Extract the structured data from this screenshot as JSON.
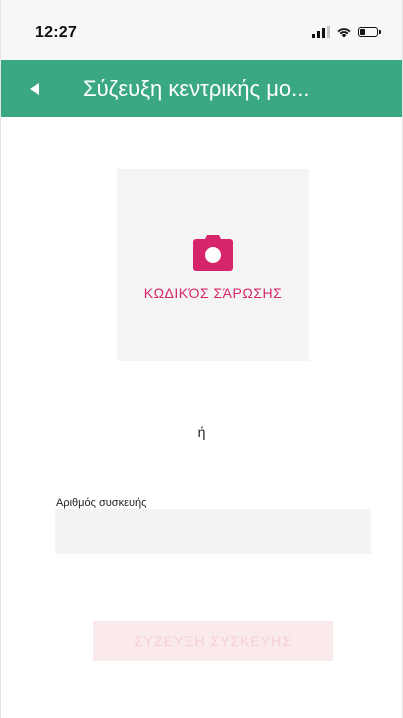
{
  "status_bar": {
    "time": "12:27",
    "icons": [
      "signal-icon",
      "wifi-icon",
      "battery-icon"
    ]
  },
  "app_bar": {
    "title": "Σύζευξη κεντρικής μο...",
    "back_icon": "back-arrow-icon",
    "color": "#3aa981"
  },
  "scan": {
    "icon": "camera-icon",
    "label": "ΚΩΔΙΚΌΣ ΣΆΡΩΣΗΣ",
    "accent_color": "#d6256a"
  },
  "divider_text": "ή",
  "device_field": {
    "label": "Αριθμός συσκευής",
    "value": "",
    "placeholder": ""
  },
  "pair_button": {
    "label": "ΣΥΖΕΥΞΗ ΣΥΣΚΕΥΗΣ",
    "state": "disabled"
  }
}
